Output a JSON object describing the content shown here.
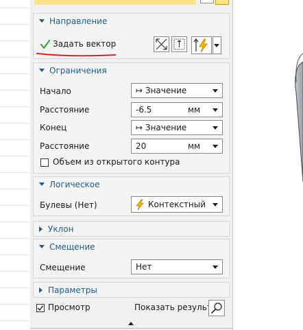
{
  "direction": {
    "header": "Направление",
    "set_vector_label": "Задать вектор"
  },
  "limits": {
    "header": "Ограничения",
    "start_label": "Начало",
    "start_value": "Значение",
    "distance1_label": "Расстояние",
    "distance1_value": "-6.5",
    "distance1_unit": "мм",
    "end_label": "Конец",
    "end_value": "Значение",
    "distance2_label": "Расстояние",
    "distance2_value": "20",
    "distance2_unit": "мм",
    "open_profile_label": "Объем из открытого контура",
    "open_profile_checked": false
  },
  "logic": {
    "header": "Логическое",
    "boolean_label": "Булевы (Нет)",
    "boolean_value": "Контекстный"
  },
  "draft": {
    "header": "Уклон"
  },
  "offset": {
    "header": "Смещение",
    "offset_label": "Смещение",
    "offset_value": "Нет"
  },
  "params": {
    "header": "Параметры"
  },
  "footer": {
    "preview_label": "Просмотр",
    "preview_checked": true,
    "show_result_label": "Показать результат"
  },
  "colors": {
    "accent": "#1d5d8c",
    "check_green": "#3aa53a",
    "red_underline": "#d92020",
    "lightning": "#f2b705",
    "yellow_bar": "#fbe38a"
  }
}
